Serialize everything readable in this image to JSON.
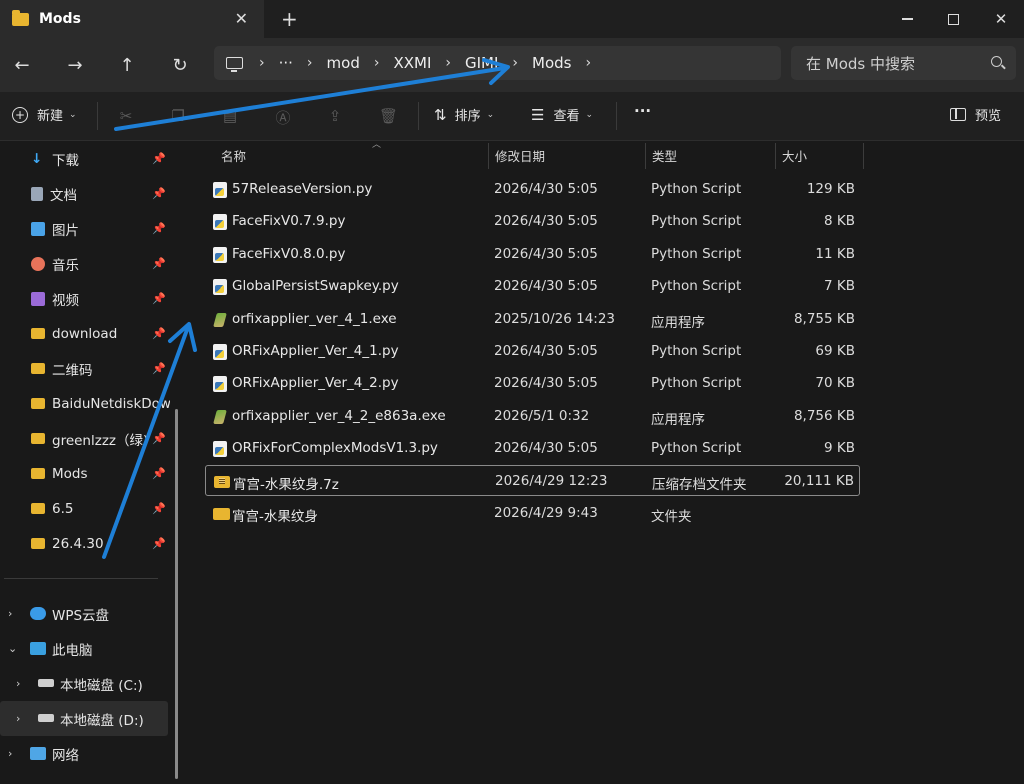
{
  "window": {
    "tab_title": "Mods",
    "close_tab": "✕",
    "new_tab": "+",
    "minimize": "",
    "maximize": "",
    "close": "✕"
  },
  "nav": {
    "back": "←",
    "forward": "→",
    "up": "↑",
    "refresh": "↻"
  },
  "breadcrumb": {
    "more": "···",
    "items": [
      "mod",
      "XXMI",
      "GIMI",
      "Mods"
    ]
  },
  "search": {
    "placeholder": "在 Mods 中搜索"
  },
  "toolbar": {
    "new_label": "新建",
    "sort_label": "排序",
    "view_label": "查看",
    "more_label": "···",
    "preview_label": "预览"
  },
  "sidebar": {
    "quick_access": [
      {
        "label": "下载",
        "icon": "download-icon",
        "color": "#3fa9f5"
      },
      {
        "label": "文档",
        "icon": "document-icon",
        "color": "#9aa7b8"
      },
      {
        "label": "图片",
        "icon": "picture-icon",
        "color": "#4aa3e8"
      },
      {
        "label": "音乐",
        "icon": "music-icon",
        "color": "#e8735a"
      },
      {
        "label": "视频",
        "icon": "video-icon",
        "color": "#9b6bd8"
      },
      {
        "label": "download",
        "icon": "folder-icon",
        "color": "#e8b530"
      },
      {
        "label": "二维码",
        "icon": "folder-icon",
        "color": "#e8b530"
      },
      {
        "label": "BaiduNetdiskDow",
        "icon": "folder-icon",
        "color": "#e8b530"
      },
      {
        "label": "greenlzzz（绿)",
        "icon": "folder-icon",
        "color": "#e8b530"
      },
      {
        "label": "Mods",
        "icon": "folder-icon",
        "color": "#e8b530"
      },
      {
        "label": "6.5",
        "icon": "folder-icon",
        "color": "#e8b530"
      },
      {
        "label": "26.4.30",
        "icon": "folder-icon",
        "color": "#e8b530"
      }
    ],
    "pin_glyph": "📌",
    "tree": [
      {
        "label": "WPS云盘",
        "chevron": "›",
        "icon": "cloud-icon"
      },
      {
        "label": "此电脑",
        "chevron": "⌄",
        "icon": "computer-icon"
      },
      {
        "label": "本地磁盘 (C:)",
        "chevron": "›",
        "icon": "drive-c-icon"
      },
      {
        "label": "本地磁盘 (D:)",
        "chevron": "›",
        "icon": "drive-d-icon"
      },
      {
        "label": "网络",
        "chevron": "›",
        "icon": "network-icon"
      }
    ]
  },
  "columns": {
    "name": "名称",
    "date": "修改日期",
    "type": "类型",
    "size": "大小"
  },
  "files": [
    {
      "name": "57ReleaseVersion.py",
      "date": "2026/4/30 5:05",
      "type": "Python Script",
      "size": "129 KB",
      "icon": "python-file-icon"
    },
    {
      "name": "FaceFixV0.7.9.py",
      "date": "2026/4/30 5:05",
      "type": "Python Script",
      "size": "8 KB",
      "icon": "python-file-icon"
    },
    {
      "name": "FaceFixV0.8.0.py",
      "date": "2026/4/30 5:05",
      "type": "Python Script",
      "size": "11 KB",
      "icon": "python-file-icon"
    },
    {
      "name": "GlobalPersistSwapkey.py",
      "date": "2026/4/30 5:05",
      "type": "Python Script",
      "size": "7 KB",
      "icon": "python-file-icon"
    },
    {
      "name": "orfixapplier_ver_4_1.exe",
      "date": "2025/10/26 14:23",
      "type": "应用程序",
      "size": "8,755 KB",
      "icon": "exe-file-icon"
    },
    {
      "name": "ORFixApplier_Ver_4_1.py",
      "date": "2026/4/30 5:05",
      "type": "Python Script",
      "size": "69 KB",
      "icon": "python-file-icon"
    },
    {
      "name": "ORFixApplier_Ver_4_2.py",
      "date": "2026/4/30 5:05",
      "type": "Python Script",
      "size": "70 KB",
      "icon": "python-file-icon"
    },
    {
      "name": "orfixapplier_ver_4_2_e863a.exe",
      "date": "2026/5/1 0:32",
      "type": "应用程序",
      "size": "8,756 KB",
      "icon": "exe-file-icon"
    },
    {
      "name": "ORFixForComplexModsV1.3.py",
      "date": "2026/4/30 5:05",
      "type": "Python Script",
      "size": "9 KB",
      "icon": "python-file-icon"
    },
    {
      "name": "宵宫-水果纹身.7z",
      "date": "2026/4/29 12:23",
      "type": "压缩存档文件夹",
      "size": "20,111 KB",
      "icon": "archive-icon"
    },
    {
      "name": "宵宫-水果纹身",
      "date": "2026/4/29 9:43",
      "type": "文件夹",
      "size": "",
      "icon": "folder-icon"
    }
  ],
  "colors": {
    "annotation_arrow": "#1e7fd6",
    "folder": "#e8b530"
  }
}
